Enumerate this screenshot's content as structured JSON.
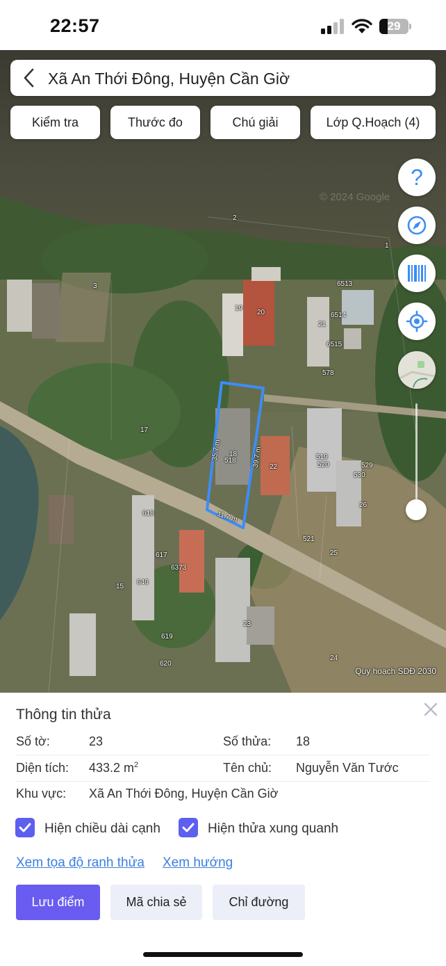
{
  "status_bar": {
    "time": "22:57",
    "battery": "29",
    "battery_level_percent": 29
  },
  "search": {
    "location": "Xã An Thới Đông, Huyện Cần Giờ"
  },
  "toolbar": {
    "check": "Kiểm tra",
    "measure": "Thước đo",
    "legend": "Chú giải",
    "layers": "Lớp Q.Hoạch (4)"
  },
  "map": {
    "copyright": "© 2024 Google",
    "source": "Quy hoạch SDĐ 2030",
    "parcel_labels": [
      "2",
      "1",
      "3",
      "6513",
      "19",
      "20",
      "6514",
      "21",
      "6515",
      "578",
      "17",
      "18",
      "518",
      "22",
      "519",
      "520",
      "529",
      "530",
      "26",
      "618",
      "617",
      "6373",
      "646",
      "15",
      "521",
      "25",
      "23",
      "619",
      "620",
      "24"
    ],
    "edge_lengths": [
      "35.7 m",
      "39.7 m",
      "11.7 m"
    ],
    "controls": [
      "help-icon",
      "compass-icon",
      "barcode-icon",
      "locate-icon",
      "layers-thumbnail"
    ],
    "colors": {
      "accent": "#3d8df5",
      "parcel_outline": "#3d8df5"
    }
  },
  "panel": {
    "title": "Thông tin thửa",
    "sheet_label": "Số tờ:",
    "sheet_value": "23",
    "parcel_label": "Số thửa:",
    "parcel_value": "18",
    "area_label": "Diện tích:",
    "area_value": "433.2 m",
    "area_unit_sup": "2",
    "owner_label": "Tên chủ:",
    "owner_value": "Nguyễn Văn Tước",
    "region_label": "Khu vực:",
    "region_value": "Xã An Thới Đông, Huyện Cần Giờ",
    "show_edges": {
      "label": "Hiện chiều dài cạnh",
      "checked": true
    },
    "show_neighbors": {
      "label": "Hiện thửa xung quanh",
      "checked": true
    },
    "link_coords": "Xem tọa độ ranh thửa",
    "link_direction": "Xem hướng",
    "save": "Lưu điểm",
    "share": "Mã chia sẻ",
    "directions": "Chỉ đường",
    "colors": {
      "primary": "#6a5cf0",
      "secondary": "#eceef8",
      "link": "#3b7fe0"
    }
  }
}
